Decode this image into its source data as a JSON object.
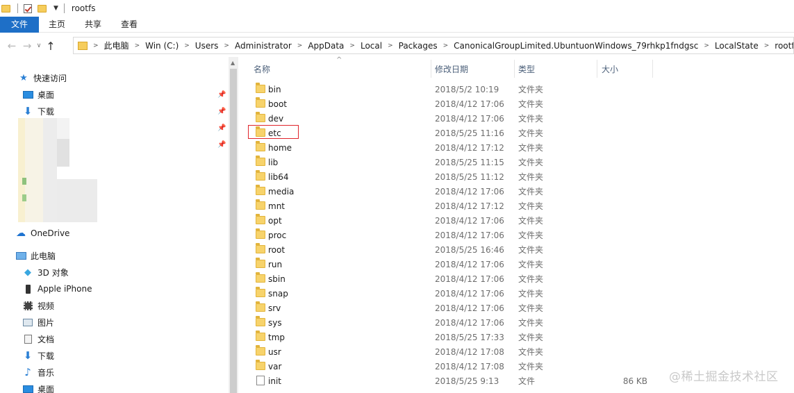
{
  "window": {
    "title": "rootfs"
  },
  "ribbon": {
    "tabs": [
      "文件",
      "主页",
      "共享",
      "查看"
    ]
  },
  "address": {
    "crumbs": [
      "此电脑",
      "Win (C:)",
      "Users",
      "Administrator",
      "AppData",
      "Local",
      "Packages",
      "CanonicalGroupLimited.UbuntuonWindows_79rhkp1fndgsc",
      "LocalState",
      "rootfs"
    ]
  },
  "sidebar": {
    "quick_access": "快速访问",
    "pinned": [
      "桌面",
      "下载"
    ],
    "onedrive": "OneDrive",
    "this_pc": "此电脑",
    "pc_items": [
      "3D 对象",
      "Apple iPhone",
      "视频",
      "图片",
      "文档",
      "下载",
      "音乐",
      "桌面"
    ]
  },
  "columns": {
    "name": "名称",
    "modified": "修改日期",
    "type": "类型",
    "size": "大小"
  },
  "files": [
    {
      "name": "bin",
      "date": "2018/5/2 10:19",
      "type": "文件夹",
      "size": "",
      "kind": "folder"
    },
    {
      "name": "boot",
      "date": "2018/4/12 17:06",
      "type": "文件夹",
      "size": "",
      "kind": "folder"
    },
    {
      "name": "dev",
      "date": "2018/4/12 17:06",
      "type": "文件夹",
      "size": "",
      "kind": "folder"
    },
    {
      "name": "etc",
      "date": "2018/5/25 11:16",
      "type": "文件夹",
      "size": "",
      "kind": "folder"
    },
    {
      "name": "home",
      "date": "2018/4/12 17:12",
      "type": "文件夹",
      "size": "",
      "kind": "folder"
    },
    {
      "name": "lib",
      "date": "2018/5/25 11:15",
      "type": "文件夹",
      "size": "",
      "kind": "folder"
    },
    {
      "name": "lib64",
      "date": "2018/5/25 11:12",
      "type": "文件夹",
      "size": "",
      "kind": "folder"
    },
    {
      "name": "media",
      "date": "2018/4/12 17:06",
      "type": "文件夹",
      "size": "",
      "kind": "folder"
    },
    {
      "name": "mnt",
      "date": "2018/4/12 17:12",
      "type": "文件夹",
      "size": "",
      "kind": "folder"
    },
    {
      "name": "opt",
      "date": "2018/4/12 17:06",
      "type": "文件夹",
      "size": "",
      "kind": "folder"
    },
    {
      "name": "proc",
      "date": "2018/4/12 17:06",
      "type": "文件夹",
      "size": "",
      "kind": "folder"
    },
    {
      "name": "root",
      "date": "2018/5/25 16:46",
      "type": "文件夹",
      "size": "",
      "kind": "folder"
    },
    {
      "name": "run",
      "date": "2018/4/12 17:06",
      "type": "文件夹",
      "size": "",
      "kind": "folder"
    },
    {
      "name": "sbin",
      "date": "2018/4/12 17:06",
      "type": "文件夹",
      "size": "",
      "kind": "folder"
    },
    {
      "name": "snap",
      "date": "2018/4/12 17:06",
      "type": "文件夹",
      "size": "",
      "kind": "folder"
    },
    {
      "name": "srv",
      "date": "2018/4/12 17:06",
      "type": "文件夹",
      "size": "",
      "kind": "folder"
    },
    {
      "name": "sys",
      "date": "2018/4/12 17:06",
      "type": "文件夹",
      "size": "",
      "kind": "folder"
    },
    {
      "name": "tmp",
      "date": "2018/5/25 17:33",
      "type": "文件夹",
      "size": "",
      "kind": "folder"
    },
    {
      "name": "usr",
      "date": "2018/4/12 17:08",
      "type": "文件夹",
      "size": "",
      "kind": "folder"
    },
    {
      "name": "var",
      "date": "2018/4/12 17:08",
      "type": "文件夹",
      "size": "",
      "kind": "folder"
    },
    {
      "name": "init",
      "date": "2018/5/25 9:13",
      "type": "文件",
      "size": "86 KB",
      "kind": "file"
    }
  ],
  "highlighted_item": "etc",
  "watermark": "@稀土掘金技术社区",
  "colors": {
    "file_tab": "#1e6fc7",
    "folder": "#f7d36b",
    "highlight_box": "#e0242b",
    "header_text": "#4c607a"
  }
}
